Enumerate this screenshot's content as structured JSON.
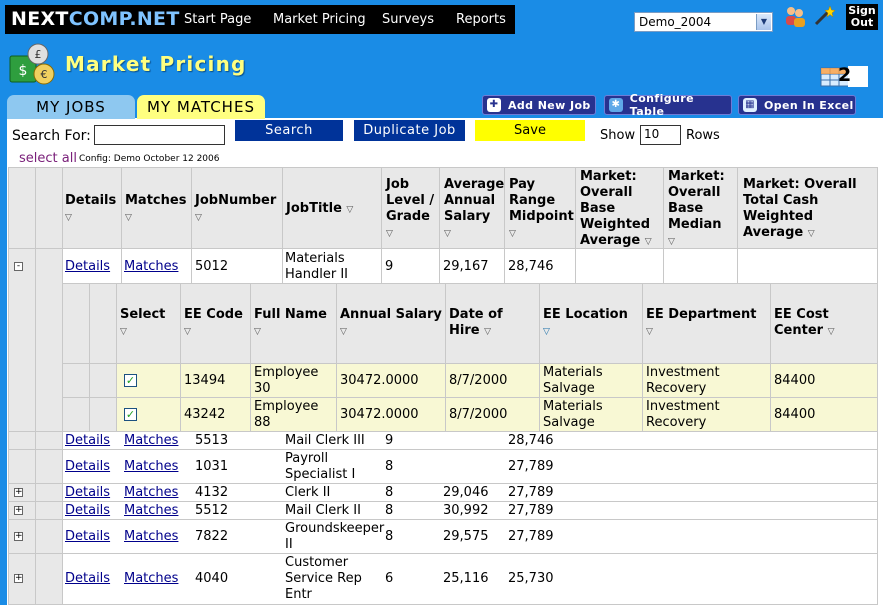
{
  "nav": {
    "brand_part1": "NEXT",
    "brand_part2": "COMP.NET",
    "items": [
      {
        "label": "Start Page"
      },
      {
        "label": "Market Pricing"
      },
      {
        "label": "Surveys"
      },
      {
        "label": "Reports"
      }
    ],
    "workspace": "Demo_2004",
    "signout": [
      "Sign",
      "Out"
    ]
  },
  "page": {
    "title": "Market Pricing",
    "grid_badge": "2"
  },
  "tabs": [
    {
      "label": "MY JOBS",
      "active": false
    },
    {
      "label": "MY MATCHES",
      "active": true
    }
  ],
  "actions": {
    "add_job": "Add New Job",
    "configure": "Configure Table",
    "excel": "Open In Excel"
  },
  "toolbar": {
    "search_label": "Search For:",
    "search_value": "",
    "search_button": "Search",
    "duplicate_button": "Duplicate Job",
    "save_button": "Save",
    "show_label": "Show",
    "rows_value": "10",
    "rows_label": "Rows",
    "select_all": "select all",
    "config": "Config: Demo October 12 2006"
  },
  "grid": {
    "headers": {
      "details": "Details",
      "matches": "Matches",
      "jobnumber": "JobNumber",
      "jobtitle": "JobTitle",
      "level": [
        "Job",
        "Level /",
        "Grade"
      ],
      "avg_salary": [
        "Average",
        "Annual",
        "Salary"
      ],
      "pay_mid": [
        "Pay",
        "Range",
        "Midpoint"
      ],
      "overall_base_wavg": [
        "Market:",
        "Overall",
        "Base",
        "Weighted",
        "Average"
      ],
      "overall_base_median": [
        "Market:",
        "Overall",
        "Base",
        "Median"
      ],
      "total_cash_wavg": [
        "Market: Overall",
        "Total Cash",
        "Weighted",
        "Average"
      ]
    },
    "rows": [
      {
        "expander": "-",
        "details": "Details",
        "matches": "Matches",
        "jobnumber": "5012",
        "jobtitle": [
          "Materials",
          "Handler II"
        ],
        "level": "9",
        "avg_salary": "29,167",
        "pay_mid": "28,746"
      },
      {
        "expander": "",
        "details": "Details",
        "matches": "Matches",
        "jobnumber": "5513",
        "jobtitle": [
          "Mail Clerk III"
        ],
        "level": "9",
        "avg_salary": "",
        "pay_mid": "28,746"
      },
      {
        "expander": "",
        "details": "Details",
        "matches": "Matches",
        "jobnumber": "1031",
        "jobtitle": [
          "Payroll",
          "Specialist I"
        ],
        "level": "8",
        "avg_salary": "",
        "pay_mid": "27,789"
      },
      {
        "expander": "+",
        "details": "Details",
        "matches": "Matches",
        "jobnumber": "4132",
        "jobtitle": [
          "Clerk II"
        ],
        "level": "8",
        "avg_salary": "29,046",
        "pay_mid": "27,789"
      },
      {
        "expander": "+",
        "details": "Details",
        "matches": "Matches",
        "jobnumber": "5512",
        "jobtitle": [
          "Mail Clerk II"
        ],
        "level": "8",
        "avg_salary": "30,992",
        "pay_mid": "27,789"
      },
      {
        "expander": "+",
        "details": "Details",
        "matches": "Matches",
        "jobnumber": "7822",
        "jobtitle": [
          "Groundskeeper",
          "II"
        ],
        "level": "8",
        "avg_salary": "29,575",
        "pay_mid": "27,789"
      },
      {
        "expander": "+",
        "details": "Details",
        "matches": "Matches",
        "jobnumber": "4040",
        "jobtitle": [
          "Customer",
          "Service Rep",
          "Entr"
        ],
        "level": "6",
        "avg_salary": "25,116",
        "pay_mid": "25,730"
      }
    ],
    "sub": {
      "headers": {
        "select": "Select",
        "ee_code": "EE Code",
        "full_name": "Full Name",
        "annual_salary": "Annual Salary",
        "date_of_hire": [
          "Date of",
          "Hire"
        ],
        "ee_location": "EE Location",
        "ee_department": "EE Department",
        "ee_cost_center": [
          "EE Cost",
          "Center"
        ]
      },
      "rows": [
        {
          "checked": true,
          "ee_code": "13494",
          "full_name": [
            "Employee",
            "30"
          ],
          "annual_salary": "30472.0000",
          "date_of_hire": "8/7/2000",
          "ee_location": [
            "Materials",
            "Salvage"
          ],
          "ee_department": [
            "Investment",
            "Recovery"
          ],
          "ee_cost_center": "84400"
        },
        {
          "checked": true,
          "ee_code": "43242",
          "full_name": [
            "Employee",
            "88"
          ],
          "annual_salary": "30472.0000",
          "date_of_hire": "8/7/2000",
          "ee_location": [
            "Materials",
            "Salvage"
          ],
          "ee_department": [
            "Investment",
            "Recovery"
          ],
          "ee_cost_center": "84400"
        }
      ]
    }
  },
  "colors": {
    "background": "#1a8ce6",
    "title": "#ffff80",
    "active_tab": "#ffff80",
    "save": "#ffff00",
    "button": "#003399"
  }
}
